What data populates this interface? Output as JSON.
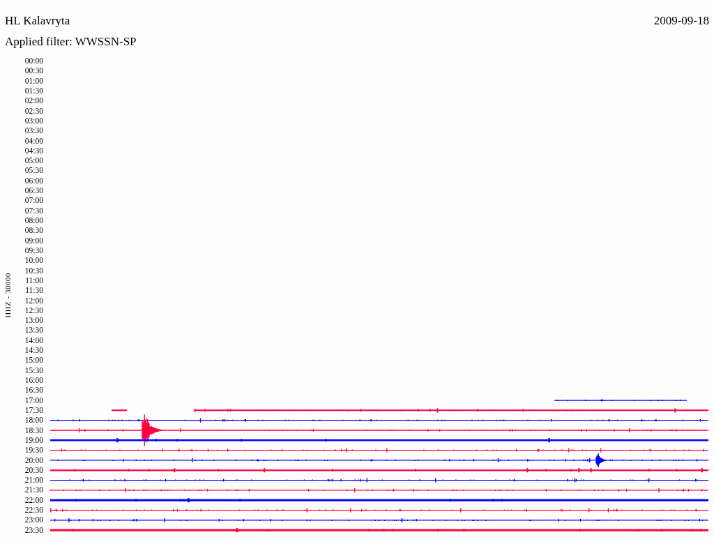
{
  "header": {
    "station": "HL Kalavryta",
    "date": "2009-09-18",
    "filter": "Applied filter: WWSSN-SP"
  },
  "channel_label": "HHZ - 30000",
  "rows": [
    {
      "time": "00:00",
      "kind": "empty"
    },
    {
      "time": "00:30",
      "kind": "empty"
    },
    {
      "time": "01:00",
      "kind": "empty"
    },
    {
      "time": "01:30",
      "kind": "empty"
    },
    {
      "time": "02:00",
      "kind": "empty"
    },
    {
      "time": "02:30",
      "kind": "empty"
    },
    {
      "time": "03:00",
      "kind": "empty"
    },
    {
      "time": "03:30",
      "kind": "empty"
    },
    {
      "time": "04:00",
      "kind": "empty"
    },
    {
      "time": "04:30",
      "kind": "empty"
    },
    {
      "time": "05:00",
      "kind": "empty"
    },
    {
      "time": "05:30",
      "kind": "empty"
    },
    {
      "time": "06:00",
      "kind": "empty"
    },
    {
      "time": "06:30",
      "kind": "empty"
    },
    {
      "time": "07:00",
      "kind": "empty"
    },
    {
      "time": "07:30",
      "kind": "empty"
    },
    {
      "time": "08:00",
      "kind": "empty"
    },
    {
      "time": "08:30",
      "kind": "empty"
    },
    {
      "time": "09:00",
      "kind": "empty"
    },
    {
      "time": "09:30",
      "kind": "empty"
    },
    {
      "time": "10:00",
      "kind": "empty"
    },
    {
      "time": "10:30",
      "kind": "empty"
    },
    {
      "time": "11:00",
      "kind": "empty"
    },
    {
      "time": "11:30",
      "kind": "empty"
    },
    {
      "time": "12:00",
      "kind": "empty"
    },
    {
      "time": "12:30",
      "kind": "empty"
    },
    {
      "time": "13:00",
      "kind": "empty"
    },
    {
      "time": "13:30",
      "kind": "empty"
    },
    {
      "time": "14:00",
      "kind": "empty"
    },
    {
      "time": "14:30",
      "kind": "empty"
    },
    {
      "time": "15:00",
      "kind": "empty"
    },
    {
      "time": "15:30",
      "kind": "empty"
    },
    {
      "time": "16:00",
      "kind": "empty"
    },
    {
      "time": "16:30",
      "kind": "empty"
    },
    {
      "time": "17:00",
      "kind": "partial",
      "color": "#0000ff"
    },
    {
      "time": "17:30",
      "kind": "partial",
      "color": "#ff0040"
    },
    {
      "time": "18:00",
      "kind": "full",
      "color": "#0000ff"
    },
    {
      "time": "18:30",
      "kind": "full",
      "color": "#ff0040"
    },
    {
      "time": "19:00",
      "kind": "full",
      "color": "#0000ff"
    },
    {
      "time": "19:30",
      "kind": "full",
      "color": "#ff0040"
    },
    {
      "time": "20:00",
      "kind": "full",
      "color": "#0000ff"
    },
    {
      "time": "20:30",
      "kind": "full",
      "color": "#ff0040"
    },
    {
      "time": "21:00",
      "kind": "full",
      "color": "#0000ff"
    },
    {
      "time": "21:30",
      "kind": "full",
      "color": "#ff0040"
    },
    {
      "time": "22:00",
      "kind": "full",
      "color": "#0000ff"
    },
    {
      "time": "22:30",
      "kind": "full",
      "color": "#ff0040"
    },
    {
      "time": "23:00",
      "kind": "full",
      "color": "#0000ff"
    },
    {
      "time": "23:30",
      "kind": "full",
      "color": "#ff0040"
    }
  ]
}
